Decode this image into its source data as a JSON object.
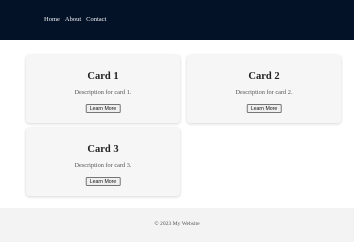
{
  "nav": {
    "links": [
      "Home",
      "About",
      "Contact"
    ]
  },
  "cards": [
    {
      "title": "Card 1",
      "description": "Description for card 1.",
      "button_label": "Learn More"
    },
    {
      "title": "Card 2",
      "description": "Description for card 2.",
      "button_label": "Learn More"
    },
    {
      "title": "Card 3",
      "description": "Description for card 3.",
      "button_label": "Learn More"
    }
  ],
  "footer": {
    "text": "© 2023 My Website"
  },
  "colors": {
    "nav_background": "#041228",
    "card_background": "#f6f6f6",
    "footer_background": "#f3f3f3"
  }
}
